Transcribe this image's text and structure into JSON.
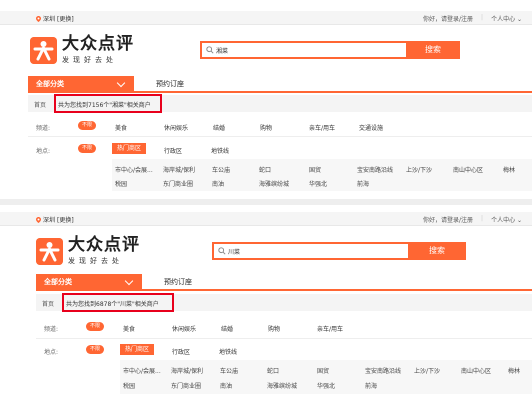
{
  "colors": {
    "brand": "#ff6633",
    "highlight_box": "#e8001c"
  },
  "icons": {
    "location": "map-pin-icon",
    "search": "magnifier-icon",
    "dropdown": "chevron-down-icon",
    "logo": "dianping-logo-icon"
  },
  "panels": [
    {
      "topbar": {
        "city": "深圳",
        "switch": "[更换]",
        "login": "你好，请登录/注册",
        "user_center": "个人中心 ⌄"
      },
      "logo": {
        "name": "大众点评",
        "slogan": "发现好去处"
      },
      "search": {
        "value": "湘菜",
        "button": "搜索"
      },
      "nav": {
        "all": "全部分类",
        "booking": "预约订座"
      },
      "breadcrumb": {
        "home": "首页",
        "result": "共为您找到7156个\"湘菜\"相关商户"
      },
      "filters": {
        "channel_label": "频道:",
        "unlimited": "不限",
        "channels": [
          "美食",
          "休闲娱乐",
          "结婚",
          "购物",
          "亲车/用车",
          "交通设施"
        ],
        "area_label": "地点:",
        "tabs": [
          "热门商区",
          "行政区",
          "地铁线"
        ],
        "areas_row1": [
          "市中心/会展...",
          "海岸城/保利",
          "车公庙",
          "蛇口",
          "国贸",
          "宝安南路沿线",
          "上沙/下沙",
          "南山中心区",
          "梅林"
        ],
        "areas_row2": [
          "税园",
          "东门商业圈",
          "南油",
          "海雅缤纷城",
          "华强北",
          "前海"
        ]
      }
    },
    {
      "topbar": {
        "city": "深圳",
        "switch": "[更换]",
        "login": "你好，请登录/注册",
        "user_center": "个人中心 ⌄"
      },
      "logo": {
        "name": "大众点评",
        "slogan": "发现好去处"
      },
      "search": {
        "value": "川菜",
        "button": "搜索"
      },
      "nav": {
        "all": "全部分类",
        "booking": "预约订座"
      },
      "breadcrumb": {
        "home": "首页",
        "result": "共为您找到6878个\"川菜\"相关商户"
      },
      "filters": {
        "channel_label": "频道:",
        "unlimited": "不限",
        "channels": [
          "美食",
          "休闲娱乐",
          "结婚",
          "购物",
          "亲车/用车"
        ],
        "area_label": "地点:",
        "tabs": [
          "热门商区",
          "行政区",
          "地铁线"
        ],
        "areas_row1": [
          "市中心/会展...",
          "海岸城/保利",
          "车公庙",
          "蛇口",
          "国贸",
          "宝安南路沿线",
          "上沙/下沙",
          "南山中心区",
          "梅林"
        ],
        "areas_row2": [
          "税园",
          "东门商业圈",
          "南油",
          "海雅缤纷城",
          "华强北",
          "前海"
        ]
      }
    }
  ]
}
